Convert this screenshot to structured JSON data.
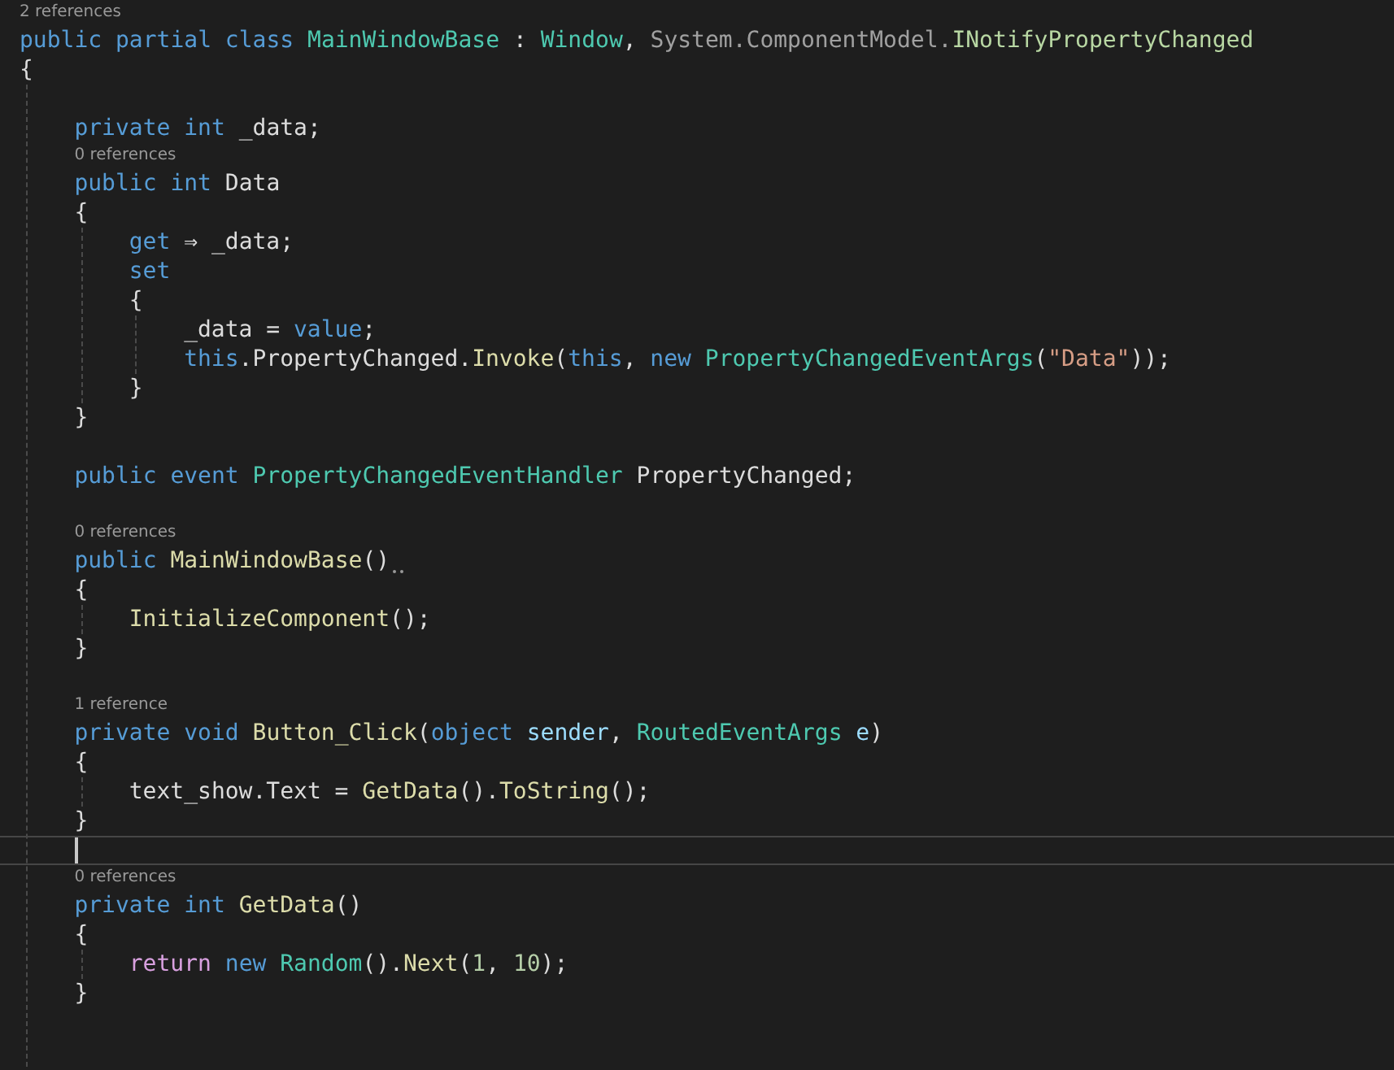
{
  "lines": [
    {
      "kind": "lens",
      "text": "2 references"
    },
    {
      "kind": "code",
      "current": false,
      "tokens": [
        {
          "kind": "keyword",
          "text": "public partial class "
        },
        {
          "kind": "type",
          "text": "MainWindowBase"
        },
        {
          "kind": "plain",
          "text": " : "
        },
        {
          "kind": "type",
          "text": "Window"
        },
        {
          "kind": "plain",
          "text": ", "
        },
        {
          "kind": "faded",
          "text": "System.ComponentModel."
        },
        {
          "kind": "interface",
          "text": "INotifyPropertyChanged"
        }
      ]
    },
    {
      "kind": "code",
      "current": false,
      "tokens": [
        {
          "kind": "plain",
          "text": "{"
        }
      ],
      "children": [
        {
          "kind": "blank"
        },
        {
          "kind": "code",
          "current": false,
          "tokens": [
            {
              "kind": "keyword",
              "text": "private int"
            },
            {
              "kind": "plain",
              "text": " _data;"
            }
          ]
        },
        {
          "kind": "lens",
          "text": "0 references"
        },
        {
          "kind": "code",
          "current": false,
          "tokens": [
            {
              "kind": "keyword",
              "text": "public int"
            },
            {
              "kind": "plain",
              "text": " Data"
            }
          ]
        },
        {
          "kind": "code",
          "current": false,
          "tokens": [
            {
              "kind": "plain",
              "text": "{"
            }
          ],
          "children": [
            {
              "kind": "code",
              "current": false,
              "tokens": [
                {
                  "kind": "keyword",
                  "text": "get"
                },
                {
                  "kind": "plain",
                  "text": " ⇒ _data;"
                }
              ]
            },
            {
              "kind": "code",
              "current": false,
              "tokens": [
                {
                  "kind": "keyword",
                  "text": "set"
                }
              ]
            },
            {
              "kind": "code",
              "current": false,
              "tokens": [
                {
                  "kind": "plain",
                  "text": "{"
                }
              ],
              "children": [
                {
                  "kind": "code",
                  "current": false,
                  "tokens": [
                    {
                      "kind": "plain",
                      "text": "_data = "
                    },
                    {
                      "kind": "keyword",
                      "text": "value"
                    },
                    {
                      "kind": "plain",
                      "text": ";"
                    }
                  ]
                },
                {
                  "kind": "code",
                  "current": false,
                  "tokens": [
                    {
                      "kind": "keyword",
                      "text": "this"
                    },
                    {
                      "kind": "plain",
                      "text": ".PropertyChanged."
                    },
                    {
                      "kind": "method",
                      "text": "Invoke"
                    },
                    {
                      "kind": "plain",
                      "text": "("
                    },
                    {
                      "kind": "keyword",
                      "text": "this"
                    },
                    {
                      "kind": "plain",
                      "text": ", "
                    },
                    {
                      "kind": "keyword",
                      "text": "new "
                    },
                    {
                      "kind": "type",
                      "text": "PropertyChangedEventArgs"
                    },
                    {
                      "kind": "plain",
                      "text": "("
                    },
                    {
                      "kind": "string",
                      "text": "\"Data\""
                    },
                    {
                      "kind": "plain",
                      "text": "));"
                    }
                  ]
                }
              ]
            },
            {
              "kind": "code",
              "current": false,
              "tokens": [
                {
                  "kind": "plain",
                  "text": "}"
                }
              ]
            }
          ]
        },
        {
          "kind": "code",
          "current": false,
          "tokens": [
            {
              "kind": "plain",
              "text": "}"
            }
          ]
        },
        {
          "kind": "blank"
        },
        {
          "kind": "code",
          "current": false,
          "tokens": [
            {
              "kind": "keyword",
              "text": "public event "
            },
            {
              "kind": "type",
              "text": "PropertyChangedEventHandler"
            },
            {
              "kind": "plain",
              "text": " PropertyChanged;"
            }
          ]
        },
        {
          "kind": "blank"
        },
        {
          "kind": "lens",
          "text": "0 references"
        },
        {
          "kind": "code",
          "current": false,
          "tokens": [
            {
              "kind": "keyword",
              "text": "public "
            },
            {
              "kind": "method",
              "text": "MainWindowBase"
            },
            {
              "kind": "plain",
              "text": "()"
            },
            {
              "kind": "hint"
            }
          ]
        },
        {
          "kind": "code",
          "current": false,
          "tokens": [
            {
              "kind": "plain",
              "text": "{"
            }
          ],
          "children": [
            {
              "kind": "code",
              "current": false,
              "tokens": [
                {
                  "kind": "method",
                  "text": "InitializeComponent"
                },
                {
                  "kind": "plain",
                  "text": "();"
                }
              ]
            }
          ]
        },
        {
          "kind": "code",
          "current": false,
          "tokens": [
            {
              "kind": "plain",
              "text": "}"
            }
          ]
        },
        {
          "kind": "blank"
        },
        {
          "kind": "lens",
          "text": "1 reference"
        },
        {
          "kind": "code",
          "current": false,
          "tokens": [
            {
              "kind": "keyword",
              "text": "private void "
            },
            {
              "kind": "method",
              "text": "Button_Click"
            },
            {
              "kind": "plain",
              "text": "("
            },
            {
              "kind": "keyword",
              "text": "object "
            },
            {
              "kind": "param",
              "text": "sender"
            },
            {
              "kind": "plain",
              "text": ", "
            },
            {
              "kind": "type",
              "text": "RoutedEventArgs"
            },
            {
              "kind": "param",
              "text": " e"
            },
            {
              "kind": "plain",
              "text": ")"
            }
          ]
        },
        {
          "kind": "code",
          "current": false,
          "tokens": [
            {
              "kind": "plain",
              "text": "{"
            }
          ],
          "children": [
            {
              "kind": "code",
              "current": false,
              "tokens": [
                {
                  "kind": "plain",
                  "text": "text_show.Text = "
                },
                {
                  "kind": "method",
                  "text": "GetData"
                },
                {
                  "kind": "plain",
                  "text": "()."
                },
                {
                  "kind": "method",
                  "text": "ToString"
                },
                {
                  "kind": "plain",
                  "text": "();"
                }
              ]
            }
          ]
        },
        {
          "kind": "code",
          "current": false,
          "tokens": [
            {
              "kind": "plain",
              "text": "}"
            }
          ]
        },
        {
          "kind": "blank",
          "current": true
        },
        {
          "kind": "lens",
          "text": "0 references"
        },
        {
          "kind": "code",
          "current": false,
          "tokens": [
            {
              "kind": "keyword",
              "text": "private int "
            },
            {
              "kind": "method",
              "text": "GetData"
            },
            {
              "kind": "plain",
              "text": "()"
            }
          ]
        },
        {
          "kind": "code",
          "current": false,
          "tokens": [
            {
              "kind": "plain",
              "text": "{"
            }
          ],
          "children": [
            {
              "kind": "code",
              "current": false,
              "tokens": [
                {
                  "kind": "control",
                  "text": "return "
                },
                {
                  "kind": "keyword",
                  "text": "new "
                },
                {
                  "kind": "type",
                  "text": "Random"
                },
                {
                  "kind": "plain",
                  "text": "()."
                },
                {
                  "kind": "method",
                  "text": "Next"
                },
                {
                  "kind": "plain",
                  "text": "("
                },
                {
                  "kind": "number",
                  "text": "1"
                },
                {
                  "kind": "plain",
                  "text": ", "
                },
                {
                  "kind": "number",
                  "text": "10"
                },
                {
                  "kind": "plain",
                  "text": ");"
                }
              ]
            }
          ]
        },
        {
          "kind": "code",
          "current": false,
          "tokens": [
            {
              "kind": "plain",
              "text": "}"
            }
          ]
        },
        {
          "kind": "blank"
        },
        {
          "kind": "blank"
        }
      ]
    }
  ]
}
